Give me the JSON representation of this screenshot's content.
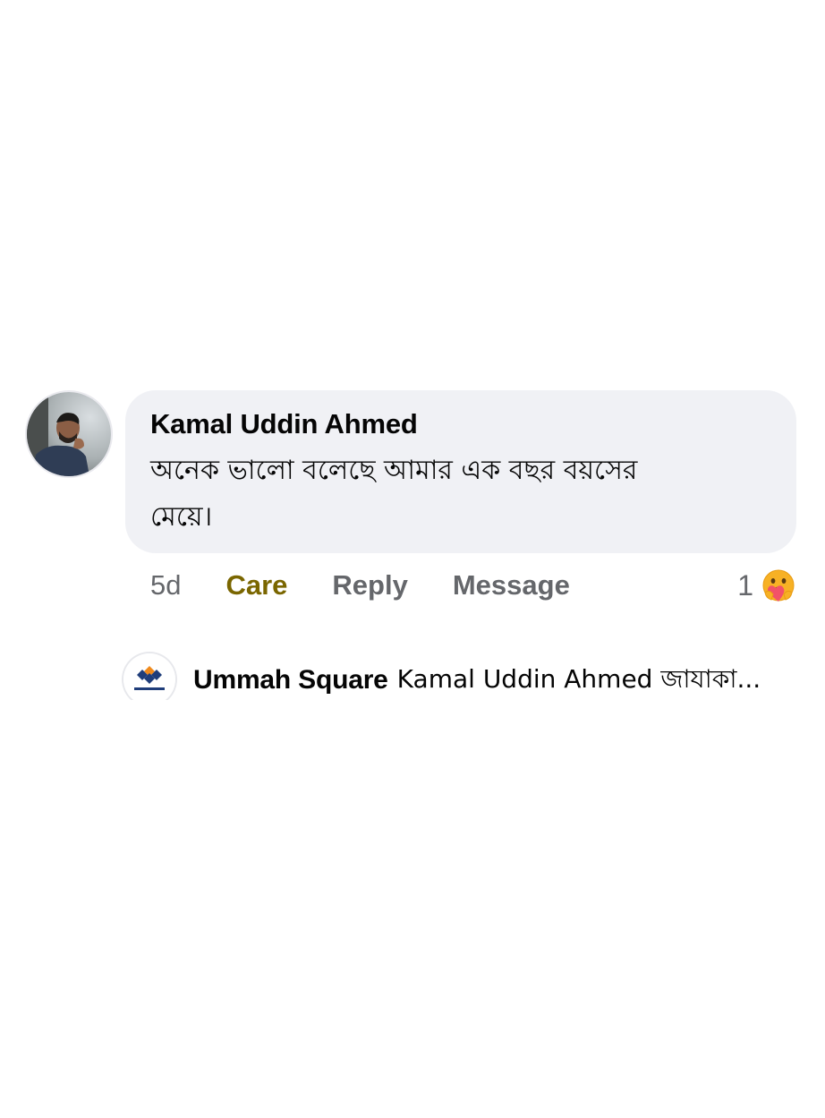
{
  "comment": {
    "author": "Kamal Uddin Ahmed",
    "text": "অনেক ভালো বলেছে আমার এক বছর বয়সের মেয়ে।",
    "avatar_icon": "user-photo-avatar"
  },
  "actions": {
    "time": "5d",
    "care_label": "Care",
    "reply_label": "Reply",
    "message_label": "Message",
    "care_color": "#7a6600",
    "muted_color": "#65676b"
  },
  "reaction": {
    "count": "1",
    "icon": "care-emoji-icon"
  },
  "reply_preview": {
    "author": "Ummah Square",
    "snippet": "Kamal Uddin Ahmed জাযাকা...",
    "avatar_icon": "ummah-square-logo"
  },
  "colors": {
    "bubble_bg": "#f0f1f5",
    "text": "#050505"
  }
}
